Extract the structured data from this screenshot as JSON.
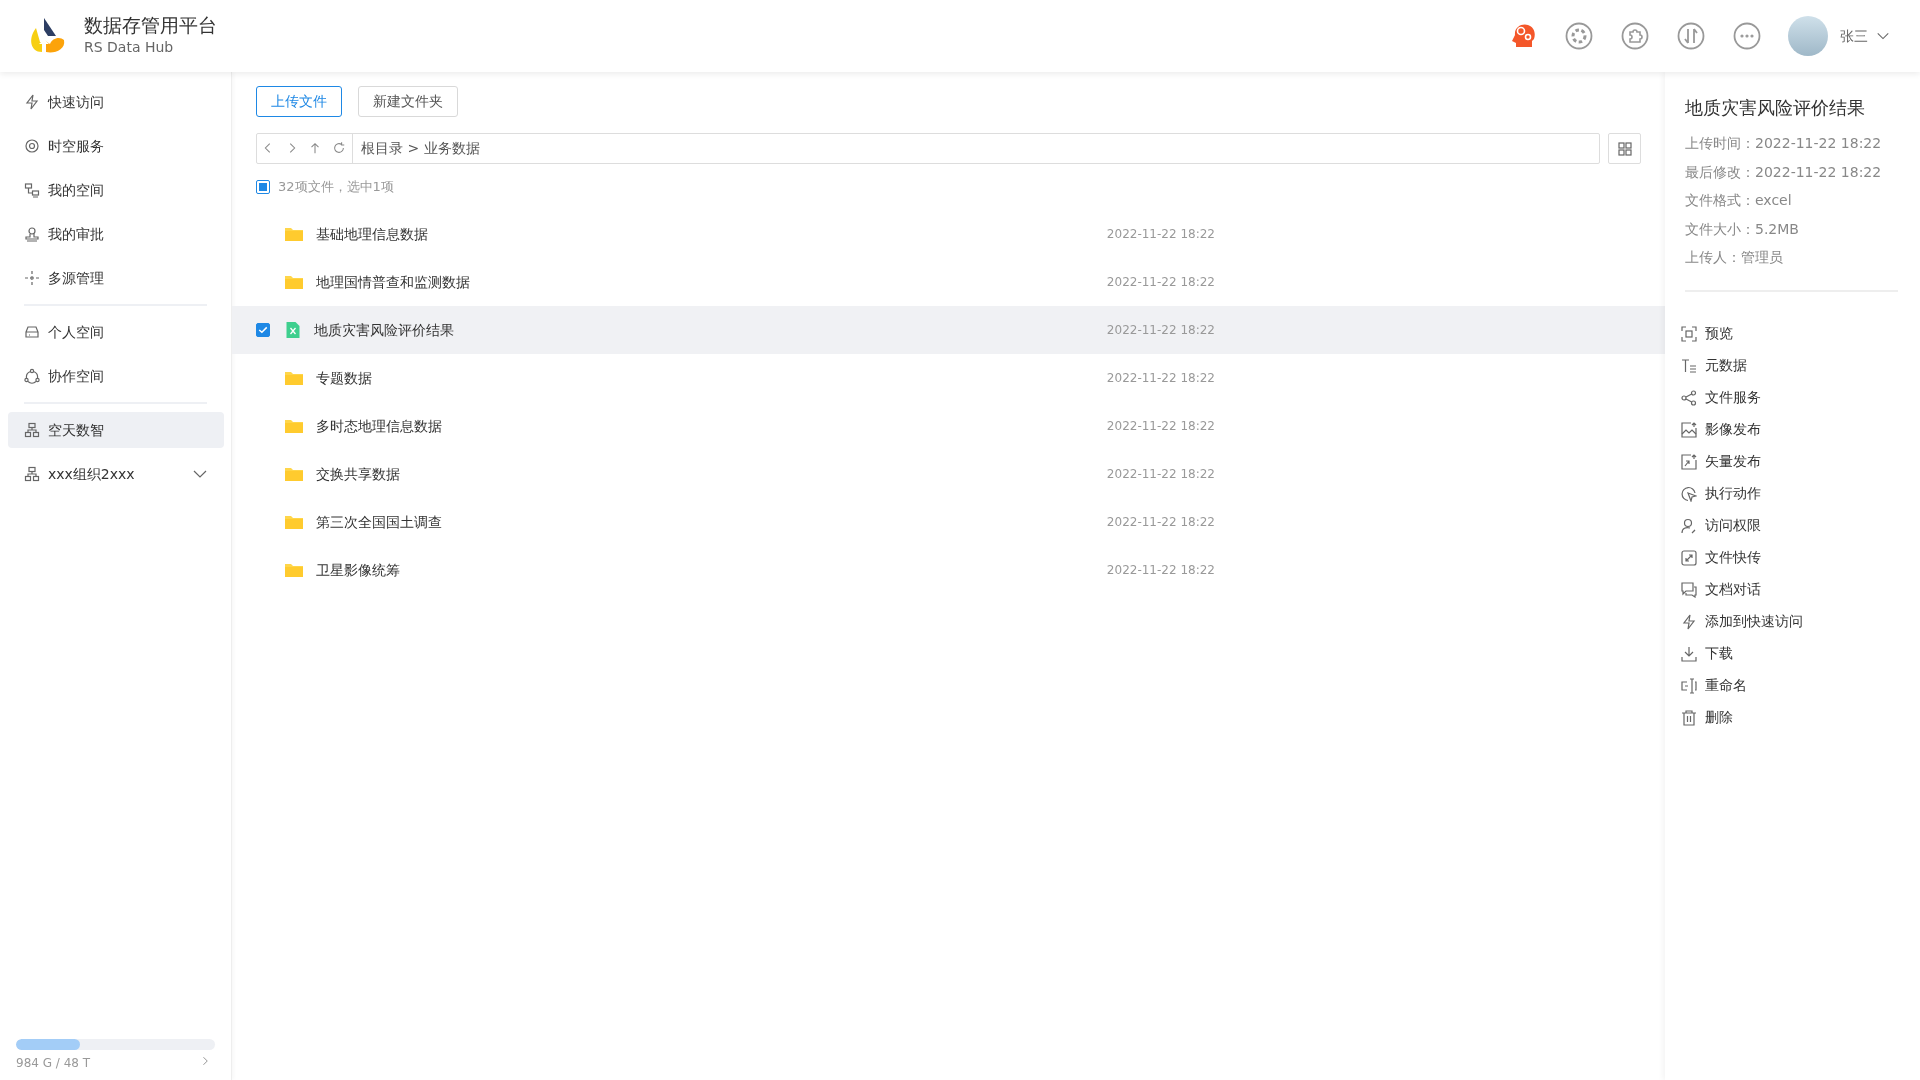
{
  "app": {
    "title": "数据存管用平台",
    "subtitle": "RS Data Hub"
  },
  "user": {
    "name": "张三"
  },
  "sidebar": {
    "groups": [
      {
        "items": [
          {
            "label": "快速访问",
            "selected": false
          },
          {
            "label": "时空服务",
            "selected": false
          },
          {
            "label": "我的空间",
            "selected": false
          },
          {
            "label": "我的审批",
            "selected": false
          },
          {
            "label": "多源管理",
            "selected": false
          }
        ]
      },
      {
        "items": [
          {
            "label": "个人空间",
            "selected": false
          },
          {
            "label": "协作空间",
            "selected": false
          }
        ]
      },
      {
        "items": [
          {
            "label": "空天数智",
            "selected": true,
            "expandable": false
          },
          {
            "label": "xxx组织2xxx",
            "selected": false,
            "expandable": true
          }
        ]
      }
    ],
    "storage": {
      "level": 0.32,
      "text": "984 G / 48 T"
    }
  },
  "toolbar": {
    "buttons": [
      {
        "label": "上传文件",
        "primary": true
      },
      {
        "label": "新建文件夹",
        "primary": false
      }
    ],
    "path": "根目录 > 业务数据"
  },
  "summary": {
    "text": "32项文件，选中1项",
    "indeterminate": true
  },
  "files": [
    {
      "name": "基础地理信息数据",
      "kind": "folder",
      "date": "2022-11-22 18:22",
      "selected": false
    },
    {
      "name": "地理国情普查和监测数据",
      "kind": "folder",
      "date": "2022-11-22 18:22",
      "selected": false
    },
    {
      "name": "地质灾害风险评价结果",
      "kind": "excel",
      "date": "2022-11-22 18:22",
      "selected": true
    },
    {
      "name": "专题数据",
      "kind": "folder",
      "date": "2022-11-22 18:22",
      "selected": false
    },
    {
      "name": "多时态地理信息数据",
      "kind": "folder",
      "date": "2022-11-22 18:22",
      "selected": false
    },
    {
      "name": "交换共享数据",
      "kind": "folder",
      "date": "2022-11-22 18:22",
      "selected": false
    },
    {
      "name": "第三次全国国土调查",
      "kind": "folder",
      "date": "2022-11-22 18:22",
      "selected": false
    },
    {
      "name": "卫星影像统筹",
      "kind": "folder",
      "date": "2022-11-22 18:22",
      "selected": false
    }
  ],
  "details": {
    "title": "地质灾害风险评价结果",
    "fields": [
      {
        "label": "上传时间：",
        "value": "2022-11-22 18:22"
      },
      {
        "label": "最后修改：",
        "value": "2022-11-22 18:22"
      },
      {
        "label": "文件格式：",
        "value": "excel"
      },
      {
        "label": "文件大小：",
        "value": "5.2MB"
      },
      {
        "label": "上传人：",
        "value": "管理员"
      }
    ],
    "actions": [
      "预览",
      "元数据",
      "文件服务",
      "影像发布",
      "矢量发布",
      "执行动作",
      "访问权限",
      "文件快传",
      "文档对话",
      "添加到快速访问",
      "下载",
      "重命名",
      "删除"
    ]
  }
}
